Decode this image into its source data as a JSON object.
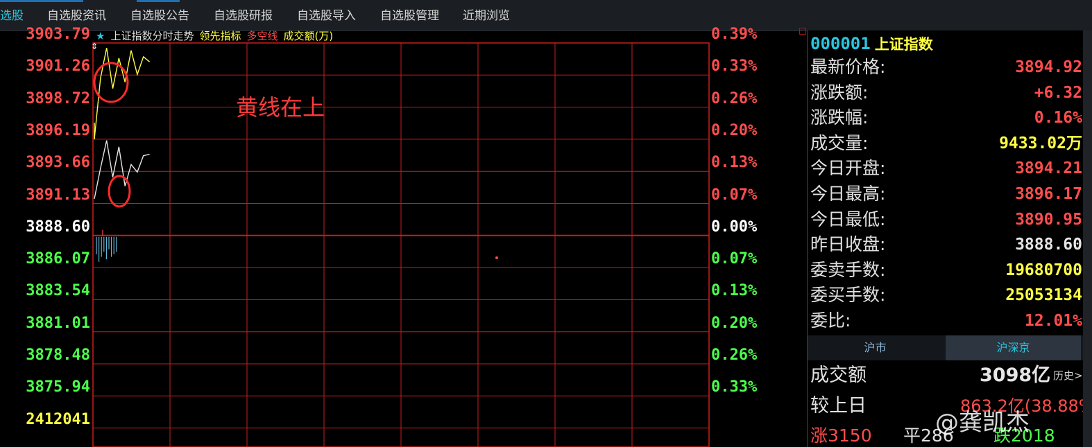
{
  "menu": {
    "tabs": [
      {
        "label": "选股",
        "active": true
      },
      {
        "label": "自选股资讯"
      },
      {
        "label": "自选股公告"
      },
      {
        "label": "自选股研报"
      },
      {
        "label": "自选股导入"
      },
      {
        "label": "自选股管理"
      },
      {
        "label": "近期浏览"
      }
    ]
  },
  "chart": {
    "legend": {
      "title": "上证指数分时走势",
      "indicator1": "领先指标",
      "indicator2": "多空线",
      "indicator3": "成交额(万)"
    },
    "left_labels": [
      "3903.79",
      "3901.26",
      "3898.72",
      "3896.19",
      "3893.66",
      "3891.13",
      "3888.60",
      "3886.07",
      "3883.54",
      "3881.01",
      "3878.48",
      "3875.94",
      "2412041"
    ],
    "right_labels": [
      "0.39%",
      "0.33%",
      "0.26%",
      "0.20%",
      "0.13%",
      "0.07%",
      "0.00%",
      "0.07%",
      "0.13%",
      "0.20%",
      "0.26%",
      "0.33%"
    ],
    "annotation": "黄线在上",
    "colors": {
      "up": "#ff4d4d",
      "down": "#4cff4c",
      "price_line": "#e6e6e6",
      "avg_line": "#ffff44",
      "grid": "#c81e1e",
      "annotation": "#ff3b3b"
    }
  },
  "chart_data": {
    "type": "line",
    "title": "上证指数分时走势",
    "ylim": [
      3873.41,
      3906.32
    ],
    "baseline": 3888.6,
    "series": [
      {
        "name": "领先指标",
        "color": "#ffff44",
        "values": [
          3896.2,
          3901.0,
          3903.4,
          3900.2,
          3902.6,
          3900.7,
          3903.2,
          3901.3,
          3902.7,
          3902.3
        ]
      },
      {
        "values": [
          3891.5,
          3893.9,
          3896.1,
          3893.2,
          3895.6,
          3892.5,
          3894.2,
          3893.6,
          3894.9,
          3895.0
        ]
      }
    ],
    "volume_bars": [
      0.7,
      1.0,
      0.8,
      0.6,
      0.9,
      0.5,
      0.8,
      0.7,
      0.6
    ]
  },
  "quote": {
    "code": "000001",
    "name": "上证指数",
    "rows": [
      {
        "label": "最新价格:",
        "value": "3894.92",
        "color": "red"
      },
      {
        "label": "涨跌额:",
        "value": "+6.32",
        "color": "red"
      },
      {
        "label": "涨跌幅:",
        "value": "0.16%",
        "color": "red"
      },
      {
        "label": "成交量:",
        "value": "9433.02万",
        "color": "yellow"
      },
      {
        "label": "今日开盘:",
        "value": "3894.21",
        "color": "red"
      },
      {
        "label": "今日最高:",
        "value": "3896.17",
        "color": "red"
      },
      {
        "label": "今日最低:",
        "value": "3890.95",
        "color": "red"
      },
      {
        "label": "昨日收盘:",
        "value": "3888.60",
        "color": "white"
      },
      {
        "label": "委卖手数:",
        "value": "19680700",
        "color": "yellow"
      },
      {
        "label": "委买手数:",
        "value": "25053134",
        "color": "yellow"
      },
      {
        "label": "委比:",
        "value": "12.01%",
        "color": "red"
      }
    ],
    "subtabs": [
      {
        "label": "沪市"
      },
      {
        "label": "沪深京",
        "active": true
      }
    ],
    "amount_label": "成交额",
    "amount_value": "3098亿",
    "history_label": "历史>",
    "compare_label": "较上日",
    "compare_value": "863.2亿(38.88%)",
    "breadth_up": "涨3150",
    "breadth_flat": "平286",
    "breadth_down": "跌2018"
  },
  "watermark": "@龚凯杰"
}
